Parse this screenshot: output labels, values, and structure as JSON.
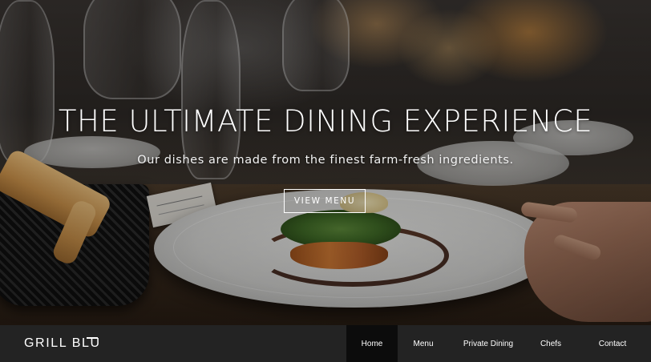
{
  "hero": {
    "title": "THE ULTIMATE DINING EXPERIENCE",
    "subtitle": "Our dishes are made from the finest farm-fresh ingredients.",
    "cta_label": "VIEW MENU"
  },
  "brand": {
    "name": "GRILL BLU"
  },
  "nav": {
    "items": [
      {
        "label": "Home",
        "active": true
      },
      {
        "label": "Menu",
        "active": false
      },
      {
        "label": "Private Dining",
        "active": false
      },
      {
        "label": "Chefs",
        "active": false
      },
      {
        "label": "Contact",
        "active": false
      }
    ]
  },
  "colors": {
    "nav_background": "#232323",
    "nav_active_background": "#0c0c0c",
    "text": "#ffffff"
  }
}
